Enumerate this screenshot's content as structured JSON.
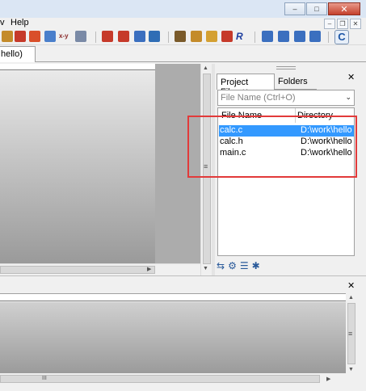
{
  "window": {
    "min_glyph": "–",
    "max_glyph": "□",
    "close_glyph": "✕"
  },
  "menubar": {
    "items": [
      {
        "label": "v"
      },
      {
        "label": "Help"
      }
    ],
    "mdi_min": "–",
    "mdi_restore": "❐",
    "mdi_close": "✕"
  },
  "toolbar": {
    "icon_colors": [
      "#c48b2a",
      "#c63a2a",
      "#d94f2a",
      "#4a7fcb",
      "#2c5fa8",
      "#7a8aa6",
      "#c63a2a",
      "#c63a2a",
      "#3b6fbf",
      "#2f6db5",
      "#7a5a2a",
      "#c48b2a",
      "#d4a032",
      "#c63a2a",
      "#1f3f9f",
      "#3b6fbf",
      "#3b6fbf",
      "#3b6fbf",
      "#3b6fbf"
    ],
    "xy_label": "x-y",
    "r_label": "R",
    "big_label": "C"
  },
  "tabs": {
    "doc_tab": "hello)"
  },
  "project_panel": {
    "tab_project": "Project Files",
    "tab_close": "✕",
    "tab_folders": "Folders",
    "close": "✕",
    "search_placeholder": "File Name (Ctrl+O)",
    "dropdown_glyph": "⌄",
    "columns": [
      "File Name",
      "Directory"
    ],
    "files": [
      {
        "name": "calc.c",
        "dir": "D:\\work\\hello",
        "selected": true
      },
      {
        "name": "calc.h",
        "dir": "D:\\work\\hello",
        "selected": false
      },
      {
        "name": "main.c",
        "dir": "D:\\work\\hello",
        "selected": false
      }
    ],
    "tools": [
      "⇆",
      "⚙",
      "☰",
      "✱"
    ]
  },
  "output": {
    "close": "✕",
    "hscroll_grip": "III"
  },
  "scroll": {
    "up": "▲",
    "down": "▼",
    "left": "◀",
    "right": "▶",
    "grip": "≡"
  },
  "highlight_color": "#e23a3a"
}
